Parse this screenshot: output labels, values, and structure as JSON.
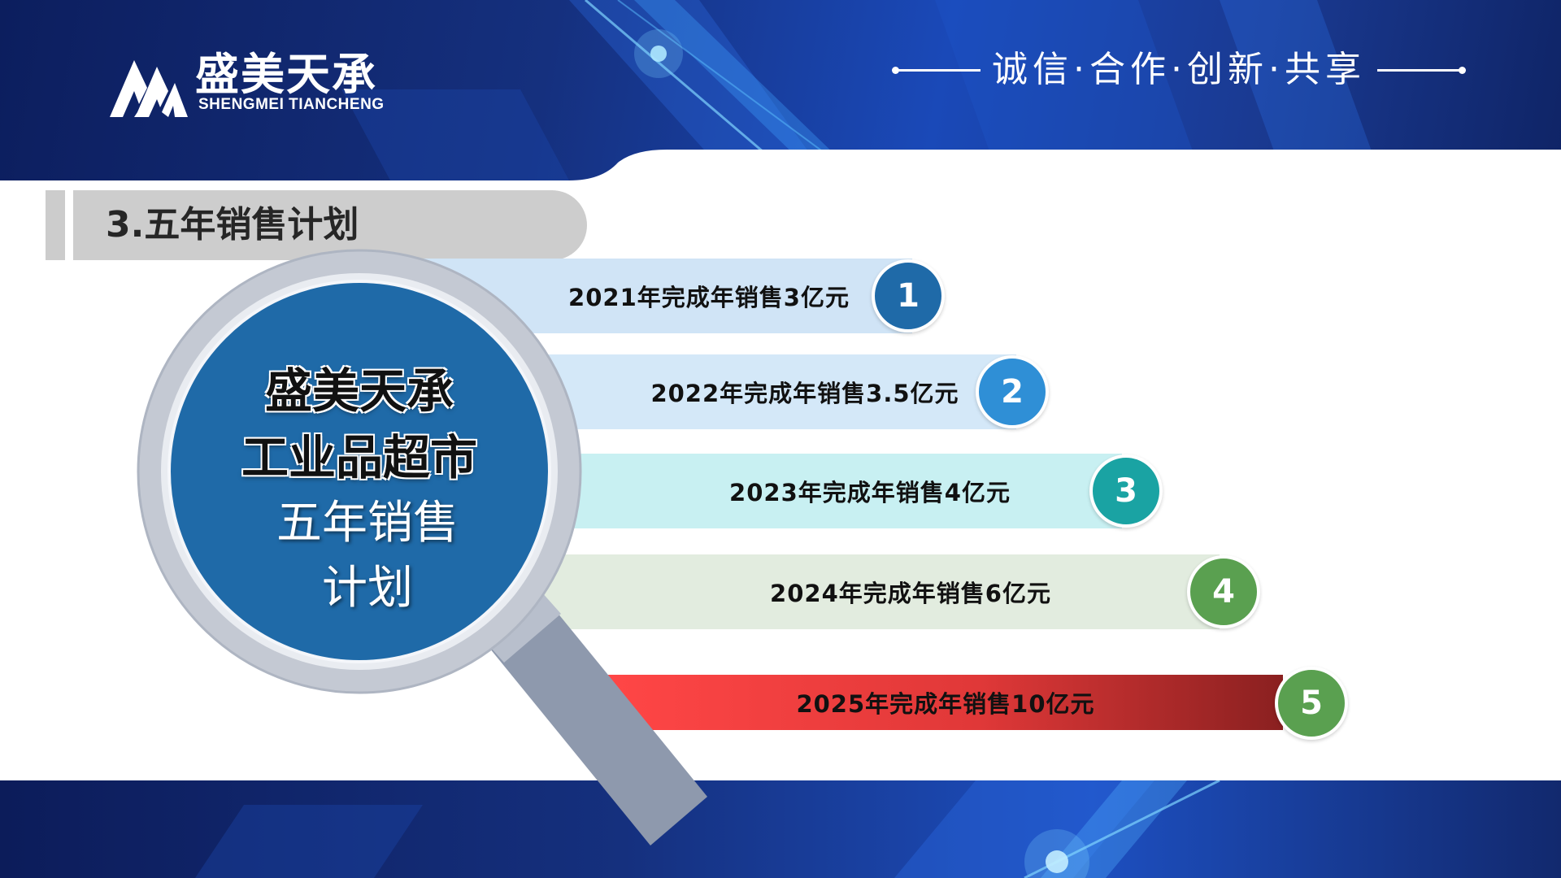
{
  "header": {
    "logo_cn": "盛美天承",
    "logo_en": "SHENGMEI TIANCHENG",
    "slogan": "诚信·合作·创新·共享"
  },
  "section": {
    "title": "3.五年销售计划"
  },
  "magnifier": {
    "line1": "盛美天承",
    "line2": "工业品超市",
    "line3": "五年销售",
    "line4": "计划"
  },
  "plan": [
    {
      "num": "1",
      "text": "2021年完成年销售3亿元",
      "bar_color": "#d0e4f6",
      "num_color": "#1f6aa8"
    },
    {
      "num": "2",
      "text": "2022年完成年销售3.5亿元",
      "bar_color": "#d4e8f8",
      "num_color": "#2f8fd6"
    },
    {
      "num": "3",
      "text": "2023年完成年销售4亿元",
      "bar_color": "#c8f0f2",
      "num_color": "#1aa3a3"
    },
    {
      "num": "4",
      "text": "2024年完成年销售6亿元",
      "bar_color": "#e2ecdf",
      "num_color": "#5aa050"
    },
    {
      "num": "5",
      "text": "2025年完成年销售10亿元",
      "bar_color": "#e64040",
      "num_color": "#5aa050"
    }
  ],
  "colors": {
    "brand_dark_blue": "#13307e",
    "lens_blue": "#1f6aa8",
    "frame_gray": "#c4c9d3"
  }
}
